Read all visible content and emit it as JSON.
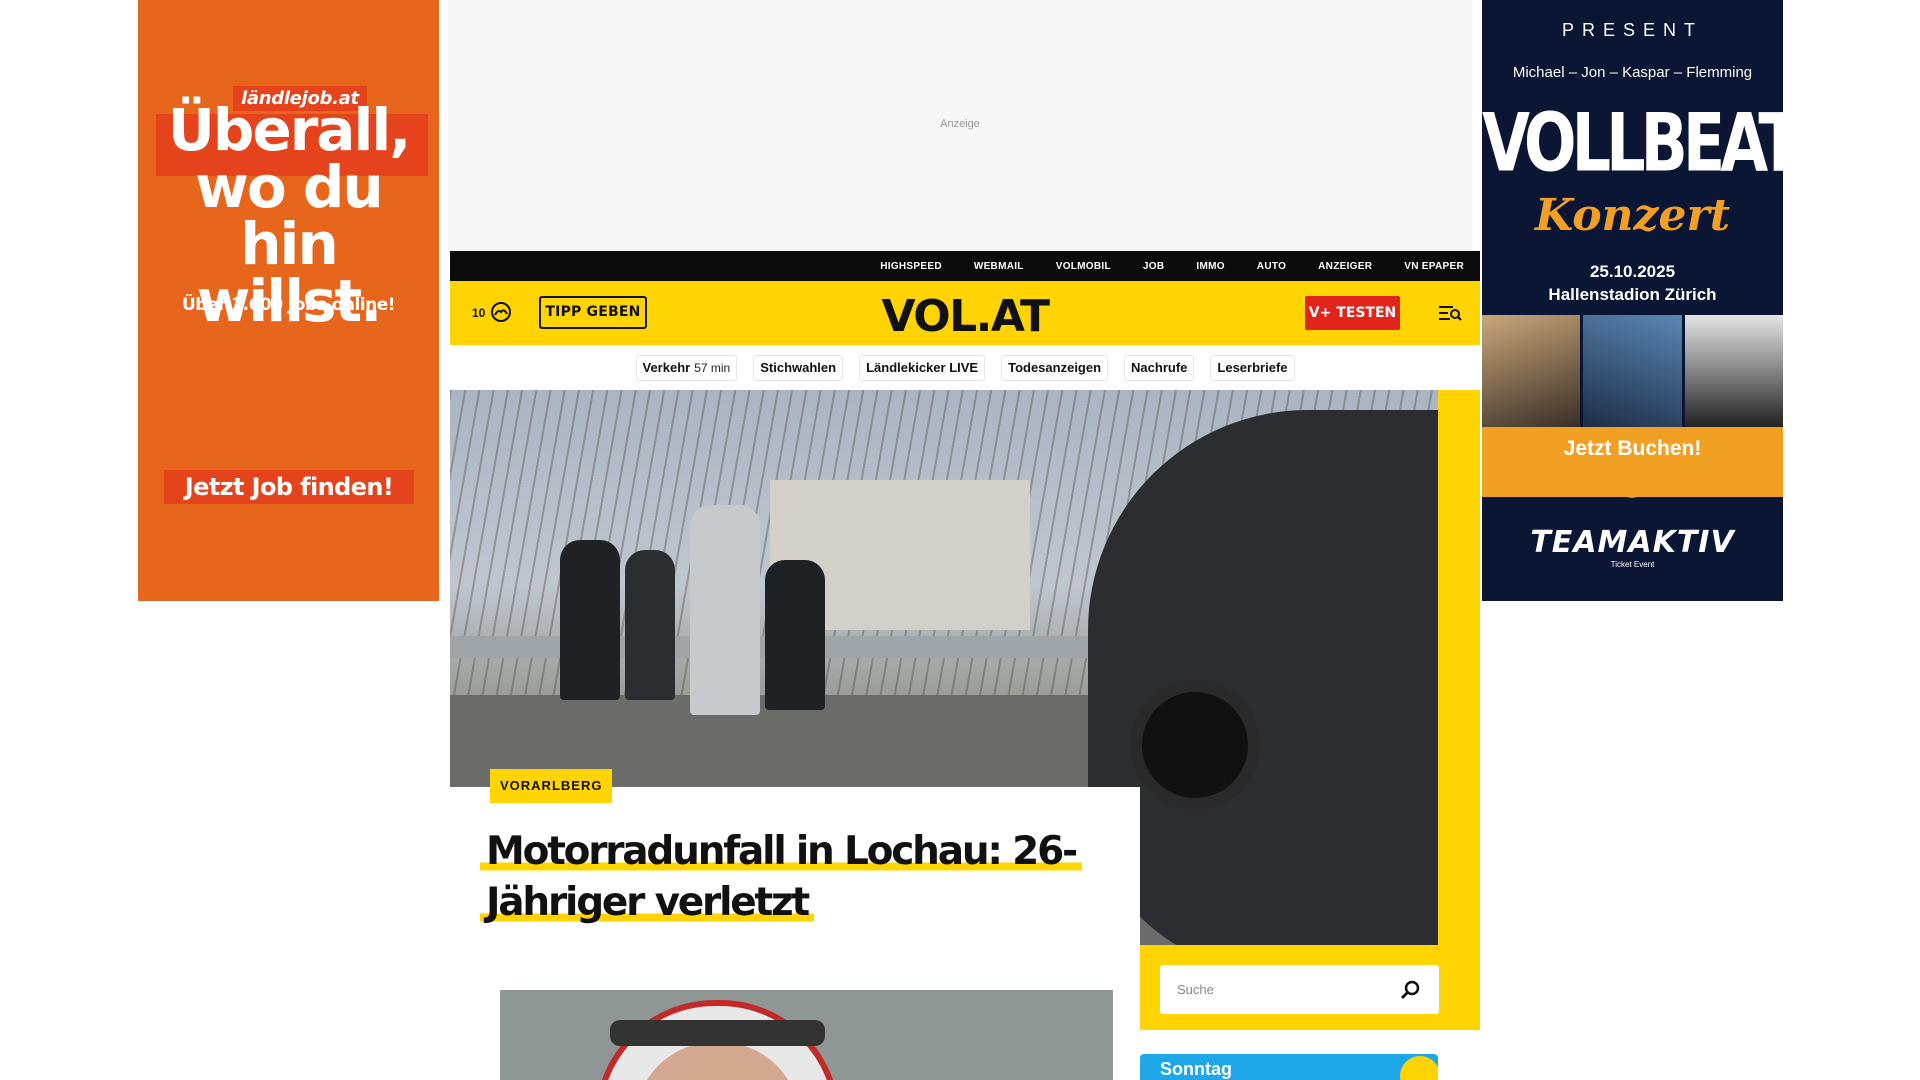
{
  "ads": {
    "left": {
      "brand": "ländlejob.at",
      "headline_1": "Überall,",
      "headline_2": "wo du hin",
      "headline_3": "willst.",
      "sub": "Über 1.600 Jobs online!",
      "cta": "Jetzt Job finden!"
    },
    "top": {
      "label": "Anzeige"
    },
    "right": {
      "present": "PRESENT",
      "names": "Michael – Jon – Kaspar – Flemming",
      "band": "VOLLBEAT",
      "event": "Konzert",
      "date": "25.10.2025",
      "venue": "Hallenstadion Zürich",
      "cta": "Jetzt Buchen!",
      "organizer": "TEAMAKTIV",
      "organizer_sub": "Ticket Event"
    }
  },
  "topnav": {
    "items": [
      "HIGHSPEED",
      "WEBMAIL",
      "VOLMOBIL",
      "JOB",
      "IMMO",
      "AUTO",
      "ANZEIGER",
      "VN EPAPER"
    ]
  },
  "header": {
    "temperature": "10",
    "tipp_label": "TIPP GEBEN",
    "logo": "VOL.AT",
    "vplus_label": "V+ TESTEN"
  },
  "quicklinks": [
    {
      "label": "Verkehr",
      "extra": "57 min"
    },
    {
      "label": "Stichwahlen"
    },
    {
      "label": "Ländlekicker LIVE"
    },
    {
      "label": "Todesanzeigen"
    },
    {
      "label": "Nachrufe"
    },
    {
      "label": "Leserbriefe"
    }
  ],
  "hero": {
    "tag": "VORARLBERG",
    "title": "Motorradunfall in Lochau: 26-Jähriger verletzt"
  },
  "search": {
    "placeholder": "Suche"
  },
  "weather": {
    "day": "Sonntag"
  },
  "colors": {
    "brand_yellow": "#ffd400",
    "accent_red": "#e1251b",
    "nav_black": "#0b0b0b",
    "ad_orange": "#e8661c",
    "weather_blue": "#1ea7e8"
  }
}
